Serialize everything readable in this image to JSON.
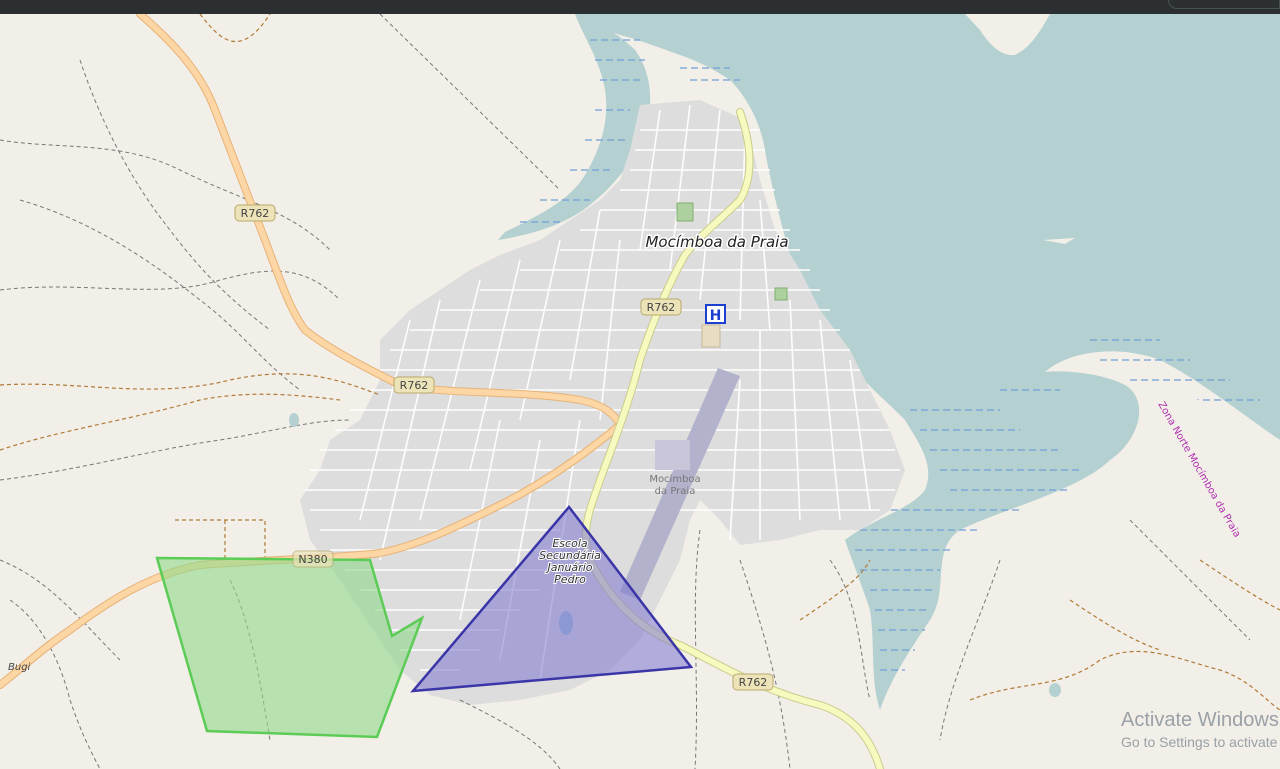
{
  "map": {
    "town_label": "Mocímboa da Praia",
    "road_labels": [
      "R762",
      "R762",
      "R762",
      "N380"
    ],
    "school_label_lines": [
      "Escola",
      "Secundária",
      "Januário",
      "Pedro"
    ],
    "airport_label_lines": [
      "Mocímboa",
      "da Praia"
    ],
    "locality_label": "Bugi",
    "coast_label": "Zona Norte Mocímboa da Praia",
    "hospital_icon_letter": "H"
  },
  "overlays": [
    {
      "shape": "polygon",
      "fill": "#8fd98a",
      "stroke": "#5ccc56"
    },
    {
      "shape": "triangle",
      "fill": "#7c74cf",
      "stroke": "#3b36a8"
    }
  ],
  "colors": {
    "land": "#f2efe9",
    "water": "#b5d0d0",
    "urban": "#dddddd",
    "trunk_road": "#fcd6a4",
    "secondary_road": "#f7fabf",
    "airport": "#b3b2cc"
  },
  "watermark": {
    "line1": "Activate Windows",
    "line2": "Go to Settings to activate Windows."
  }
}
